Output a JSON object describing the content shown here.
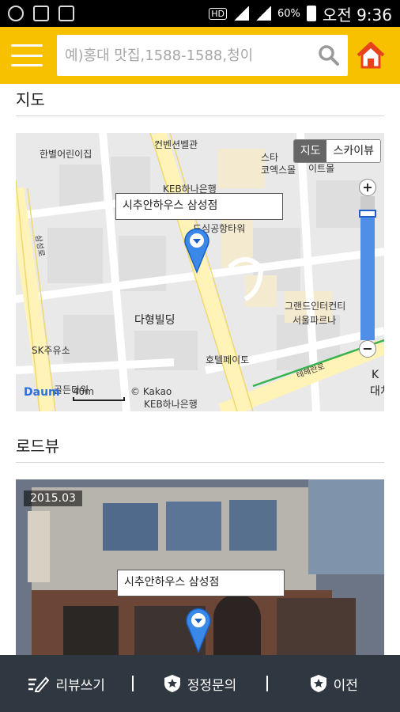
{
  "statusbar": {
    "hd": "HD",
    "battery": "60%",
    "time": "오전 9:36"
  },
  "header": {
    "search_placeholder": "예)홍대 맛집,1588-1588,청이",
    "accent_color": "#f7c100"
  },
  "sections": {
    "map_title": "지도",
    "roadview_title": "로드뷰"
  },
  "map": {
    "toggle_map": "지도",
    "toggle_sky": "스카이뷰",
    "zoom_in": "+",
    "zoom_out": "−",
    "zoom_level": 0.88,
    "callout": "시추안하우스 삼성점",
    "labels": {
      "hanbyeol": "한별어린이집",
      "convention": "컨벤션벨관",
      "star": "스타",
      "coex": "코엑스몰",
      "e_mart": "이트몰",
      "keb1": "KEB하나은행",
      "airport": "도심공항타워",
      "daehyung": "다형빌딩",
      "grand": "그랜드인터컨티",
      "seoul_parnas": "서울파르나",
      "sk": "SK주유소",
      "hotel": "호텔페이토",
      "golden": "골든타워",
      "keb2": "KEB하나은행",
      "kakao": "© Kakao",
      "road1": "삼성로",
      "road2": "테헤란로",
      "k_right": "K",
      "dae_right": "대치"
    },
    "scale": "40m",
    "logo": "Daum"
  },
  "roadview": {
    "date": "2015.03",
    "callout": "시추안하우스 삼성점"
  },
  "bottombar": {
    "review": "리뷰쓰기",
    "correction": "정정문의",
    "prev": "이전"
  }
}
